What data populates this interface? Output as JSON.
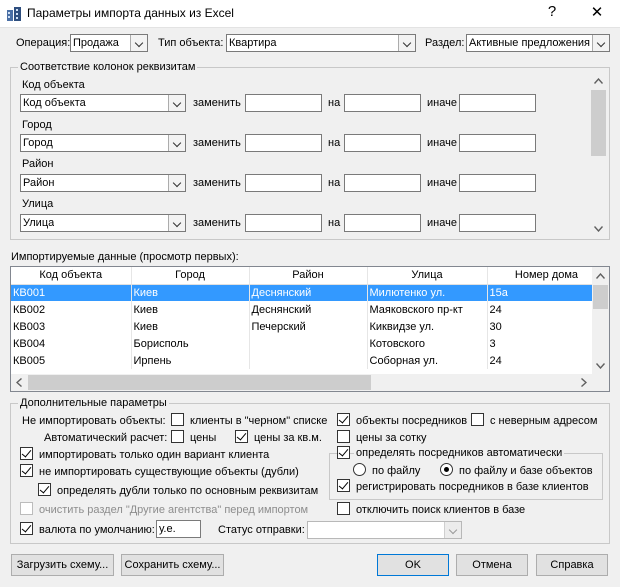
{
  "window": {
    "title": "Параметры импорта данных из Excel",
    "help_glyph": "?",
    "close_glyph": "✕"
  },
  "top": {
    "operation_label": "Операция:",
    "operation_value": "Продажа",
    "object_type_label": "Тип объекта:",
    "object_type_value": "Квартира",
    "section_label": "Раздел:",
    "section_value": "Активные предложения"
  },
  "mapping": {
    "group_title": "Соответствие колонок реквизитам",
    "replace_label": "заменить",
    "on_label": "на",
    "else_label": "иначе",
    "rows": [
      {
        "label": "Код объекта",
        "value": "Код объекта"
      },
      {
        "label": "Город",
        "value": "Город"
      },
      {
        "label": "Район",
        "value": "Район"
      },
      {
        "label": "Улица",
        "value": "Улица"
      }
    ]
  },
  "preview": {
    "title": "Импортируемые данные (просмотр первых):",
    "columns": [
      "Код объекта",
      "Город",
      "Район",
      "Улица",
      "Номер дома"
    ],
    "rows": [
      [
        "КВ001",
        "Киев",
        "Деснянский",
        "Милютенко ул.",
        "15а"
      ],
      [
        "КВ002",
        "Киев",
        "Деснянский",
        "Маяковского пр-кт",
        "24"
      ],
      [
        "КВ003",
        "Киев",
        "Печерский",
        "Киквидзе ул.",
        "30"
      ],
      [
        "КВ004",
        "Борисполь",
        "",
        "Котовского",
        "3"
      ],
      [
        "КВ005",
        "Ирпень",
        "",
        "Соборная ул.",
        "24"
      ]
    ]
  },
  "extra": {
    "group_title": "Дополнительные параметры",
    "dont_import_label": "Не импортировать объекты:",
    "blacklist_clients": "клиенты в \"черном\" списке",
    "intermediary_objects": "объекты посредников",
    "wrong_address": "с неверным адресом",
    "auto_calc_label": "Автоматический расчет:",
    "prices": "цены",
    "price_per_sqm": "цены за кв.м.",
    "price_per_hundred": "цены за сотку",
    "import_one_variant": "импортировать только один вариант клиента",
    "detect_intermediaries": "определять посредников автоматически",
    "dont_import_existing": "не импортировать существующие объекты (дубли)",
    "by_file": "по файлу",
    "by_file_and_db": "по файлу и базе объектов",
    "detect_duplicates": "определять дубли только по основным реквизитам",
    "register_intermediaries": "регистрировать посредников в базе клиентов",
    "clear_section": "очистить раздел \"Другие агентства\" перед импортом",
    "disable_client_search": "отключить поиск клиентов в базе",
    "default_currency": "валюта по умолчанию:",
    "currency_value": "у.е.",
    "send_status": "Статус отправки:",
    "send_status_value": ""
  },
  "buttons": {
    "load_scheme": "Загрузить схему...",
    "save_scheme": "Сохранить схему...",
    "ok": "OK",
    "cancel": "Отмена",
    "help": "Справка"
  },
  "colors": {
    "selection": "#3399ff",
    "accent": "#0078d7"
  }
}
